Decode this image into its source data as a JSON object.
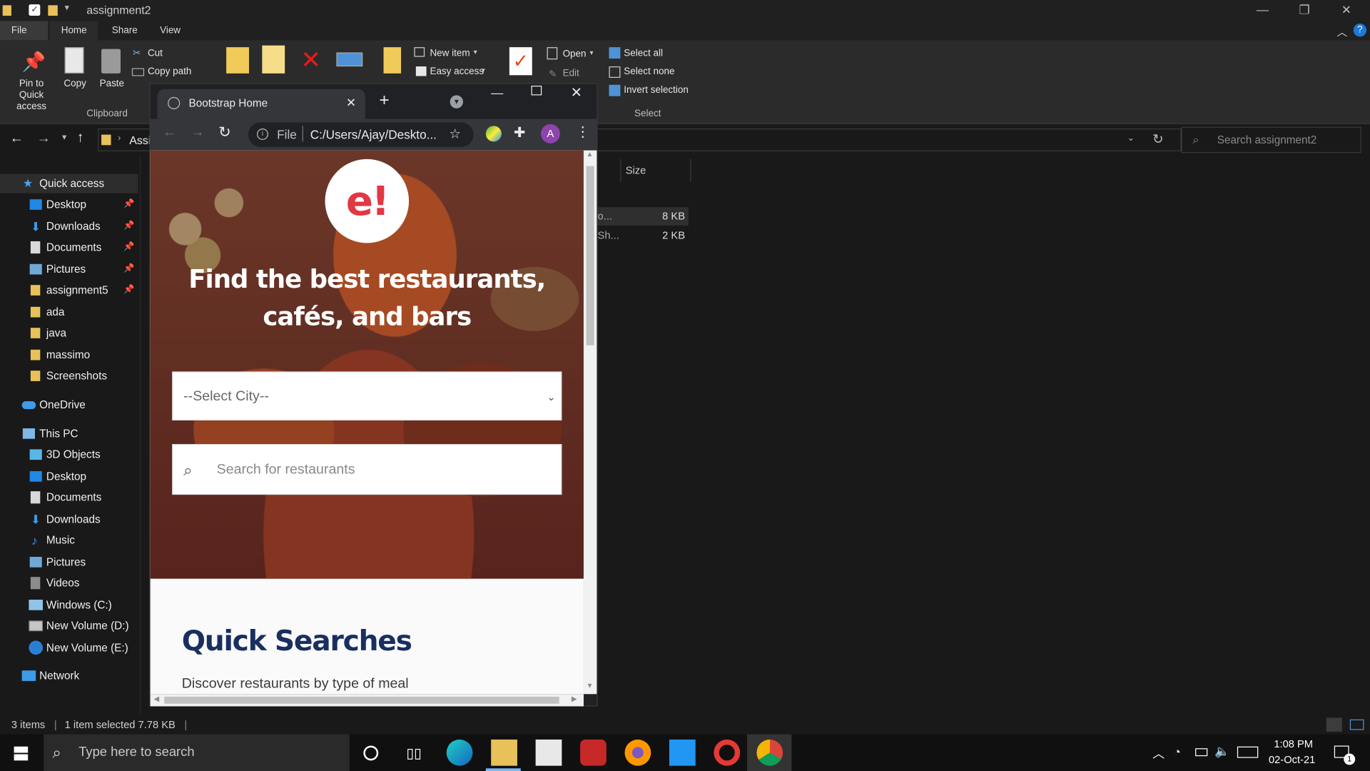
{
  "explorer": {
    "title": "assignment2",
    "ribbon_tabs": [
      "File",
      "Home",
      "Share",
      "View"
    ],
    "clipboard": {
      "pin_label": "Pin to Quick access",
      "copy_label": "Copy",
      "paste_label": "Paste",
      "cut_label": "Cut",
      "copy_path_label": "Copy path",
      "group_label": "Clipboard"
    },
    "new_group": {
      "new_item": "New item",
      "easy_access": "Easy access"
    },
    "open_group": {
      "open": "Open",
      "edit": "Edit"
    },
    "select_group": {
      "select_all": "Select all",
      "select_none": "Select none",
      "invert": "Invert selection",
      "group_label": "Select"
    },
    "address_partial": "Assi",
    "search_placeholder": "Search assignment2",
    "columns": {
      "size": "Size"
    },
    "files": [
      {
        "name_partial": "o...",
        "size": "8 KB"
      },
      {
        "name_partial": "Sh...",
        "size": "2 KB"
      }
    ],
    "nav": [
      {
        "label": "Quick access",
        "pinned": false
      },
      {
        "label": "Desktop",
        "pinned": true
      },
      {
        "label": "Downloads",
        "pinned": true
      },
      {
        "label": "Documents",
        "pinned": true
      },
      {
        "label": "Pictures",
        "pinned": true
      },
      {
        "label": "assignment5",
        "pinned": true
      },
      {
        "label": "ada",
        "pinned": false
      },
      {
        "label": "java",
        "pinned": false
      },
      {
        "label": "massimo",
        "pinned": false
      },
      {
        "label": "Screenshots",
        "pinned": false
      },
      {
        "label": "OneDrive",
        "pinned": false
      },
      {
        "label": "This PC",
        "pinned": false
      },
      {
        "label": "3D Objects",
        "pinned": false
      },
      {
        "label": "Desktop",
        "pinned": false
      },
      {
        "label": "Documents",
        "pinned": false
      },
      {
        "label": "Downloads",
        "pinned": false
      },
      {
        "label": "Music",
        "pinned": false
      },
      {
        "label": "Pictures",
        "pinned": false
      },
      {
        "label": "Videos",
        "pinned": false
      },
      {
        "label": "Windows (C:)",
        "pinned": false
      },
      {
        "label": "New Volume (D:)",
        "pinned": false
      },
      {
        "label": "New Volume (E:)",
        "pinned": false
      },
      {
        "label": "Network",
        "pinned": false
      }
    ],
    "status": {
      "items": "3 items",
      "selected": "1 item selected  7.78 KB"
    }
  },
  "browser": {
    "tab_title": "Bootstrap Home",
    "omnibox_scheme": "File",
    "omnibox_url": "C:/Users/Ajay/Deskto...",
    "profile_initial": "A",
    "page": {
      "logo": "e!",
      "hero_title": "Find the best restaurants, cafés, and bars",
      "city_select": "--Select City--",
      "search_placeholder": "Search for restaurants",
      "quick_searches_title": "Quick Searches",
      "quick_searches_sub": "Discover restaurants by type of meal"
    }
  },
  "taskbar": {
    "search_placeholder": "Type here to search",
    "time": "1:08 PM",
    "date": "02-Oct-21",
    "notification_count": "1"
  }
}
